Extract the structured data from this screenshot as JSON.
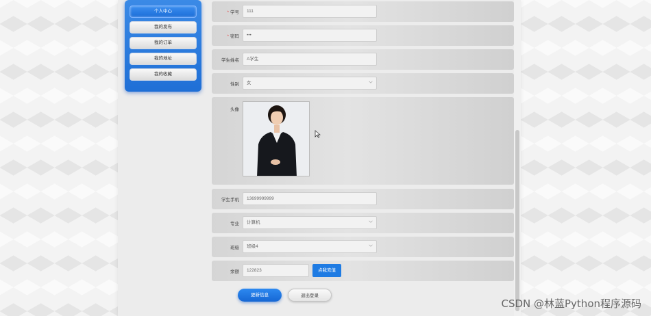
{
  "sidebar": {
    "items": [
      {
        "label": "个人中心",
        "active": true
      },
      {
        "label": "我的发布",
        "active": false
      },
      {
        "label": "我的订单",
        "active": false
      },
      {
        "label": "我的地址",
        "active": false
      },
      {
        "label": "我的收藏",
        "active": false
      }
    ]
  },
  "form": {
    "student_id": {
      "label": "学号",
      "required": "*",
      "value": "111"
    },
    "password": {
      "label": "密码",
      "required": "*",
      "value": "•••"
    },
    "student_name": {
      "label": "学生姓名",
      "value": "A学生"
    },
    "gender": {
      "label": "性别",
      "value": "女"
    },
    "avatar": {
      "label": "头像"
    },
    "phone": {
      "label": "学生手机",
      "value": "13699999999"
    },
    "major": {
      "label": "专业",
      "value": "计算机"
    },
    "class": {
      "label": "班级",
      "value": "班级4"
    },
    "balance": {
      "label": "余额",
      "value": "122823"
    }
  },
  "buttons": {
    "recharge": "点我充值",
    "update": "更新信息",
    "logout": "退出登录"
  },
  "watermark": "CSDN @林蓝Python程序源码",
  "colors": {
    "accent": "#1e7be3",
    "required": "#e54b4b"
  }
}
